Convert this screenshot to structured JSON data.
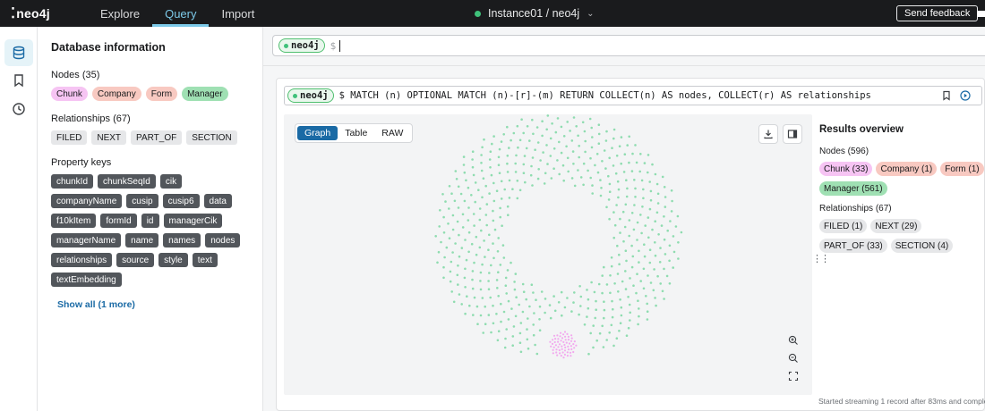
{
  "topbar": {
    "logo": "neo4j",
    "tabs": [
      {
        "label": "Explore",
        "active": false
      },
      {
        "label": "Query",
        "active": true
      },
      {
        "label": "Import",
        "active": false
      }
    ],
    "instance": "Instance01 / neo4j",
    "feedback_label": "Send feedback"
  },
  "db_info": {
    "title": "Database information",
    "nodes_label": "Nodes (35)",
    "node_labels": [
      {
        "label": "Chunk",
        "color": "#f6c4f3"
      },
      {
        "label": "Company",
        "color": "#f8c9c1"
      },
      {
        "label": "Form",
        "color": "#f8c9c1"
      },
      {
        "label": "Manager",
        "color": "#9fe0b3"
      }
    ],
    "relationships_label": "Relationships (67)",
    "relationship_types": [
      "FILED",
      "NEXT",
      "PART_OF",
      "SECTION"
    ],
    "property_keys_label": "Property keys",
    "property_keys": [
      "chunkId",
      "chunkSeqId",
      "cik",
      "companyName",
      "cusip",
      "cusip6",
      "data",
      "f10kItem",
      "formId",
      "id",
      "managerCik",
      "managerName",
      "name",
      "names",
      "nodes",
      "relationships",
      "source",
      "style",
      "text",
      "textEmbedding"
    ],
    "show_all": "Show all (1 more)"
  },
  "editor": {
    "db": "neo4j",
    "prompt": "$"
  },
  "result": {
    "db": "neo4j",
    "query": "$ MATCH (n) OPTIONAL MATCH (n)-[r]-(m) RETURN COLLECT(n) AS nodes, COLLECT(r) AS relationships",
    "views": [
      {
        "label": "Graph",
        "active": true
      },
      {
        "label": "Table",
        "active": false
      },
      {
        "label": "RAW",
        "active": false
      }
    ],
    "overview": {
      "title": "Results overview",
      "nodes_label": "Nodes (596)",
      "node_chips": [
        {
          "label": "Chunk (33)",
          "color": "#f6c4f3"
        },
        {
          "label": "Company (1)",
          "color": "#f8c9c1"
        },
        {
          "label": "Form (1)",
          "color": "#f8c9c1"
        },
        {
          "label": "Manager (561)",
          "color": "#9fe0b3"
        }
      ],
      "relationships_label": "Relationships (67)",
      "rel_chips": [
        "FILED (1)",
        "NEXT (29)",
        "PART_OF (33)",
        "SECTION (4)"
      ]
    },
    "status": "Started streaming 1 record after 83ms and complet"
  },
  "colors": {
    "manager_node": "#8fdcb0",
    "chunk_node": "#f2a9ee",
    "accent": "#1a6aa5"
  }
}
